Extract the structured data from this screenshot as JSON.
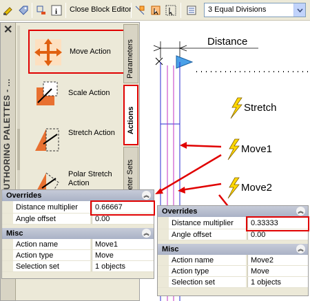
{
  "toolbar": {
    "close_label": "Close Block Editor",
    "visibility_value": "3 Equal Divisions",
    "icons": [
      "block-editor-icon",
      "tag-icon",
      "swap-icon",
      "info-icon",
      "parameter-icon",
      "action-icon",
      "select-icon",
      "visibility-icon"
    ]
  },
  "palette": {
    "title": "BLOCK AUTHORING PALETTES - ...",
    "tools": [
      {
        "label": "Move Action"
      },
      {
        "label": "Scale Action"
      },
      {
        "label": "Stretch Action"
      },
      {
        "label": "Polar Stretch Action"
      }
    ],
    "tabs": [
      "Parameters",
      "Actions",
      "Parameter Sets"
    ]
  },
  "drawing": {
    "distance_label": "Distance",
    "stretch_label": "Stretch",
    "move1_label": "Move1",
    "move2_label": "Move2"
  },
  "panel1": {
    "overrides_header": "Overrides",
    "rows": [
      {
        "name": "Distance multiplier",
        "value": "0.66667"
      },
      {
        "name": "Angle offset",
        "value": "0.00"
      }
    ],
    "misc_header": "Misc",
    "misc_rows": [
      {
        "name": "Action name",
        "value": "Move1"
      },
      {
        "name": "Action type",
        "value": "Move"
      },
      {
        "name": "Selection set",
        "value": "1 objects"
      }
    ]
  },
  "panel2": {
    "overrides_header": "Overrides",
    "rows": [
      {
        "name": "Distance multiplier",
        "value": "0.33333"
      },
      {
        "name": "Angle offset",
        "value": "0.00"
      }
    ],
    "misc_header": "Misc",
    "misc_rows": [
      {
        "name": "Action name",
        "value": "Move2"
      },
      {
        "name": "Action type",
        "value": "Move"
      },
      {
        "name": "Selection set",
        "value": "1 objects"
      }
    ]
  },
  "colors": {
    "highlight": "#e00000",
    "accent": "#3b5ba5"
  }
}
